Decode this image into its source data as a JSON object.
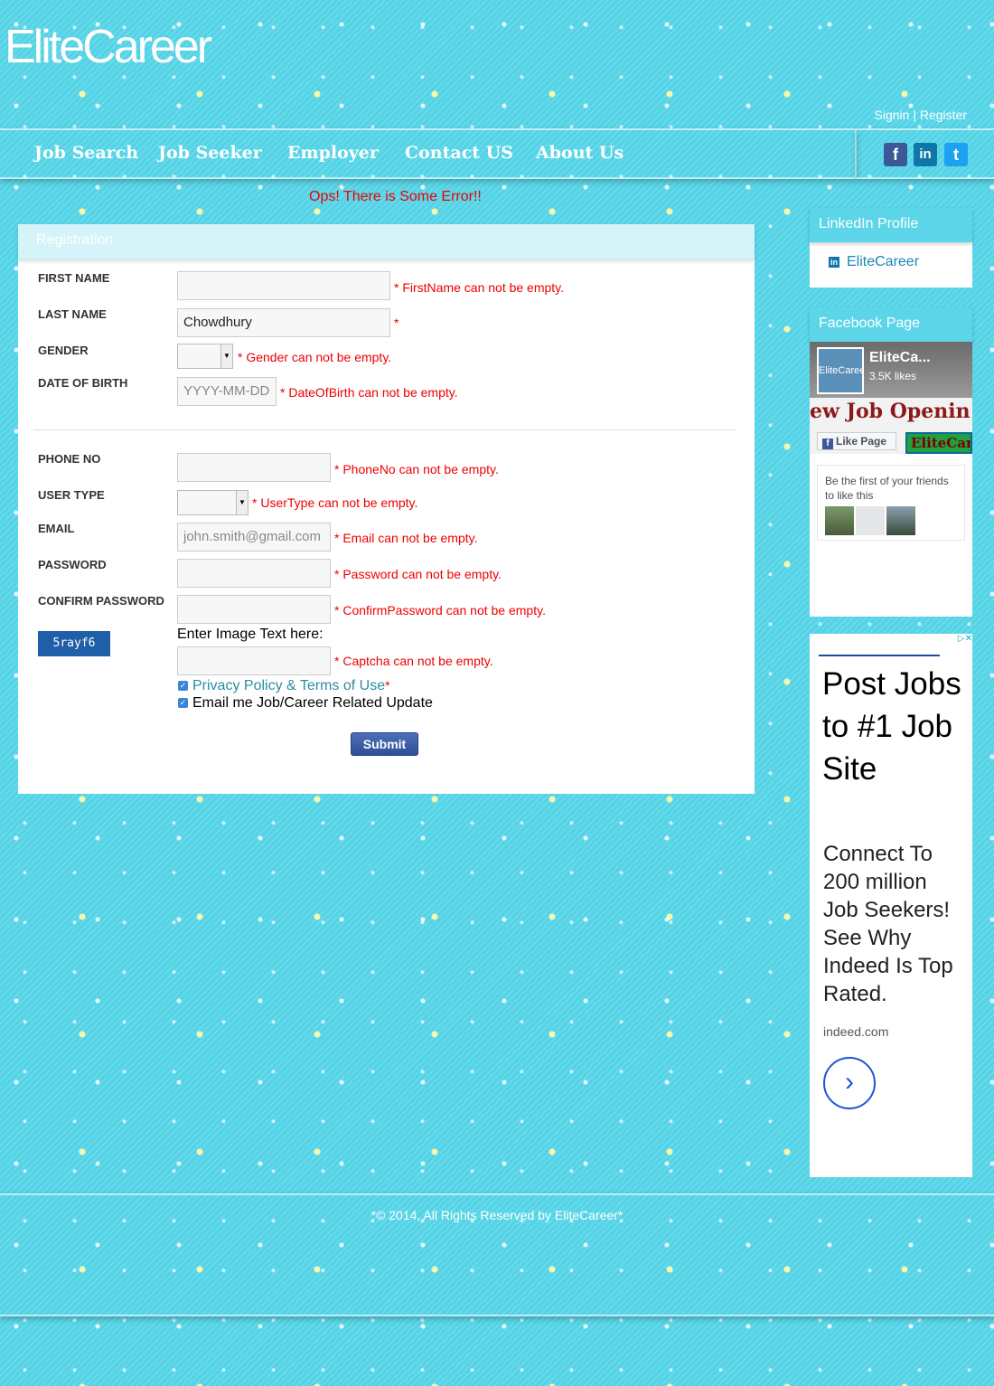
{
  "header": {
    "logo": "EliteCareer",
    "signin": "Signin",
    "separator": "|",
    "register": "Register"
  },
  "nav": {
    "items": [
      "Job Search",
      "Job Seeker",
      "Employer",
      "Contact US",
      "About Us"
    ]
  },
  "social": {
    "facebook": "f",
    "linkedin": "in",
    "twitter": "t"
  },
  "error_banner": "Ops! There is Some Error!!",
  "registration": {
    "title": "Registration",
    "first_name": {
      "label": "FIRST NAME",
      "value": "",
      "error": "* FirstName can not be empty."
    },
    "last_name": {
      "label": "LAST NAME",
      "value": "Chowdhury",
      "error": "*"
    },
    "gender": {
      "label": "GENDER",
      "value": "",
      "error": "* Gender can not be empty."
    },
    "dob": {
      "label": "DATE OF BIRTH",
      "placeholder": "YYYY-MM-DD",
      "error": "* DateOfBirth can not be empty."
    },
    "phone": {
      "label": "PHONE NO",
      "value": "",
      "error": "* PhoneNo can not be empty."
    },
    "user_type": {
      "label": "USER TYPE",
      "value": "",
      "error": "* UserType can not be empty."
    },
    "email": {
      "label": "EMAIL",
      "placeholder": "john.smith@gmail.com",
      "error": "* Email can not be empty."
    },
    "password": {
      "label": "PASSWORD",
      "value": "",
      "error": "* Password can not be empty."
    },
    "confirm_password": {
      "label": "CONFIRM PASSWORD",
      "value": "",
      "error": "* ConfirmPassword can not be empty."
    },
    "captcha": {
      "image_text": "5rayf6",
      "label": "Enter Image Text here:",
      "value": "",
      "error": "* Captcha can not be empty."
    },
    "privacy": {
      "text": "Privacy Policy & Terms of Use",
      "required": "*",
      "checked": true
    },
    "email_updates": {
      "text": "Email me Job/Career Related Update",
      "checked": true
    },
    "submit": "Submit"
  },
  "sidebar": {
    "linkedin": {
      "title": "LinkedIn Profile",
      "link": "EliteCareer"
    },
    "facebook": {
      "title": "Facebook Page",
      "page_name": "EliteCa...",
      "likes": "3.5K likes",
      "avatar_text": "EliteCareer",
      "banner_text": "ew Job Openin",
      "like_button": "Like Page",
      "cover_logo": "EliteCar",
      "friends_text": "Be the first of your friends to like this"
    },
    "ad": {
      "headline": "Post Jobs to #1 Job Site",
      "body": "Connect To 200 million Job Seekers! See Why Indeed Is Top Rated.",
      "domain": "indeed.com"
    }
  },
  "footer": {
    "text": "*© 2014, All Rights Reserved by EliteCareer*"
  }
}
